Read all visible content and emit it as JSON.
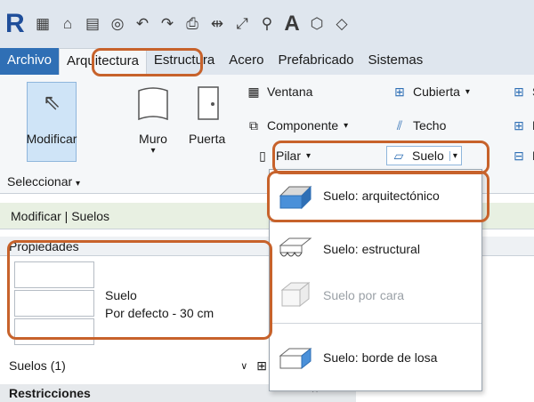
{
  "qat": {
    "logo": "R",
    "text_tool": "A"
  },
  "tabs": [
    "Archivo",
    "Arquitectura",
    "Estructura",
    "Acero",
    "Prefabricado",
    "Sistemas"
  ],
  "ribbon": {
    "modificar": "Modificar",
    "muro": "Muro",
    "puerta": "Puerta",
    "ventana": "Ventana",
    "componente": "Componente",
    "pilar": "Pilar",
    "cubierta": "Cubierta",
    "techo": "Techo",
    "suelo": "Suelo",
    "col3_s": "S",
    "col3_r": "R",
    "col3_m": "M",
    "seleccionar": "Seleccionar"
  },
  "context_bar": "Modificar | Suelos",
  "properties": {
    "header": "Propiedades",
    "type_name": "Suelo",
    "type_variant": "Por defecto - 30 cm",
    "selector": "Suelos (1)",
    "section": "Restricciones"
  },
  "dropdown": {
    "items": [
      {
        "label": "Suelo: arquitectónico",
        "enabled": true
      },
      {
        "label": "Suelo: estructural",
        "enabled": true
      },
      {
        "label": "Suelo por cara",
        "enabled": false
      },
      {
        "label": "Suelo: borde de losa",
        "enabled": true
      }
    ]
  },
  "colors": {
    "accent": "#2f6fb5",
    "highlight": "#c7622b",
    "ribbon_bg": "#f5f7f9",
    "context_bar": "#e8f0e2"
  }
}
